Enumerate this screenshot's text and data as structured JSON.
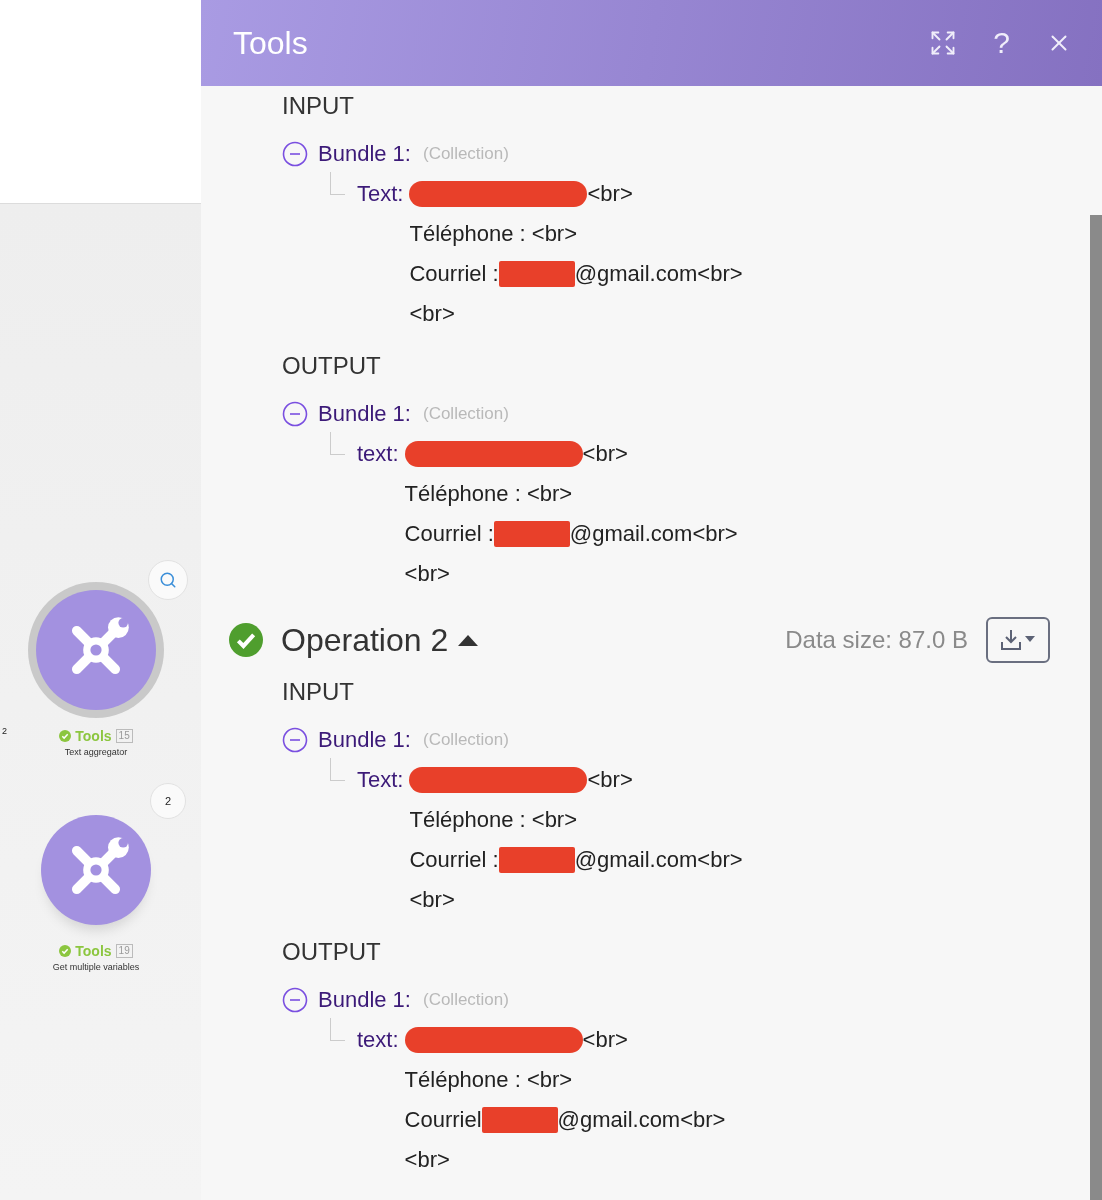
{
  "canvas": {
    "nodes": [
      {
        "title": "Tools",
        "succeeded": true,
        "number": "15",
        "caption": "Text aggregator",
        "selected": true,
        "bubble": {
          "kind": "search"
        }
      },
      {
        "title": "Tools",
        "succeeded": true,
        "number": "19",
        "caption": "Get multiple variables",
        "selected": false,
        "bubble": {
          "kind": "count",
          "text": "2"
        }
      }
    ],
    "edge_label": "2"
  },
  "panel": {
    "title": "Tools",
    "help": "?",
    "operations": [
      {
        "sections": [
          {
            "label": "INPUT",
            "bundle": "Bundle 1:",
            "type": "(Collection)",
            "expanded": true,
            "key": "Text:",
            "lines": [
              {
                "redacted": true,
                "after": "<br>"
              },
              {
                "before": "Téléphone : <br>",
                "redacted": false
              },
              {
                "before": "Courriel :",
                "redacted": true,
                "after": "@gmail.com<br>"
              },
              {
                "before": "<br>",
                "redacted": false
              }
            ]
          },
          {
            "label": "OUTPUT",
            "bundle": "Bundle 1:",
            "type": "(Collection)",
            "expanded": true,
            "key": "text:",
            "lines": [
              {
                "redacted": true,
                "after": "<br>"
              },
              {
                "before": "Téléphone : <br>",
                "redacted": false
              },
              {
                "before": "Courriel :",
                "redacted": true,
                "after": "@gmail.com<br>"
              },
              {
                "before": "<br>",
                "redacted": false
              }
            ]
          }
        ]
      },
      {
        "title": "Operation 2",
        "succeeded": true,
        "expanded": true,
        "data_size": "Data size: 87.0 B",
        "sections": [
          {
            "label": "INPUT",
            "bundle": "Bundle 1:",
            "type": "(Collection)",
            "expanded": true,
            "key": "Text:",
            "lines": [
              {
                "redacted": true,
                "after": "<br>"
              },
              {
                "before": "Téléphone : <br>",
                "redacted": false
              },
              {
                "before": "Courriel :",
                "redacted": true,
                "after": "@gmail.com<br>"
              },
              {
                "before": "<br>",
                "redacted": false
              }
            ]
          },
          {
            "label": "OUTPUT",
            "bundle": "Bundle 1:",
            "type": "(Collection)",
            "expanded": true,
            "key": "text:",
            "lines": [
              {
                "redacted": true,
                "after": "<br>"
              },
              {
                "before": "Téléphone : <br>",
                "redacted": false
              },
              {
                "before": "Courriel",
                "redacted": true,
                "after": "@gmail.com<br>"
              },
              {
                "before": "<br>",
                "redacted": false
              }
            ]
          }
        ]
      }
    ]
  }
}
